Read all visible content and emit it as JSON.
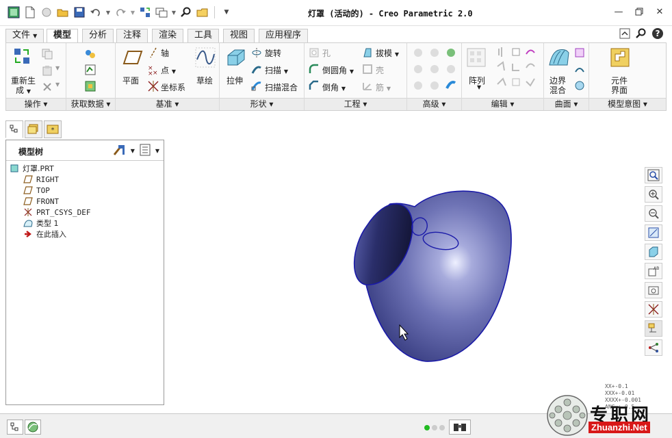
{
  "window": {
    "title": "灯罩 (活动的) - Creo Parametric 2.0"
  },
  "tabs": [
    {
      "label": "文件",
      "has_menu": true
    },
    {
      "label": "模型",
      "active": true
    },
    {
      "label": "分析"
    },
    {
      "label": "注释"
    },
    {
      "label": "渲染"
    },
    {
      "label": "工具"
    },
    {
      "label": "视图"
    },
    {
      "label": "应用程序"
    }
  ],
  "ribbon": {
    "groups": {
      "operations": "操作",
      "get_data": "获取数据",
      "datum": "基准",
      "shapes": "形状",
      "engineering": "工程",
      "advanced": "高级",
      "editing": "编辑",
      "surfaces": "曲面",
      "model_intent": "模型意图"
    },
    "buttons": {
      "regenerate_1": "重新生",
      "regenerate_2": "成",
      "plane": "平面",
      "axis": "轴",
      "point": "点",
      "csys": "坐标系",
      "sketch": "草绘",
      "extrude": "拉伸",
      "revolve": "旋转",
      "sweep": "扫描",
      "swept_blend": "扫描混合",
      "hole": "孔",
      "draft": "拔模",
      "round": "倒圆角",
      "shell": "壳",
      "chamfer": "倒角",
      "rib": "筋",
      "pattern": "阵列",
      "boundary_blend_1": "边界",
      "boundary_blend_2": "混合",
      "component_interface_1": "元件",
      "component_interface_2": "界面"
    }
  },
  "model_tree": {
    "title": "模型树",
    "nodes": [
      {
        "label": "灯罩.PRT",
        "icon": "part-icon"
      },
      {
        "label": "RIGHT",
        "icon": "datum-plane-icon"
      },
      {
        "label": "TOP",
        "icon": "datum-plane-icon"
      },
      {
        "label": "FRONT",
        "icon": "datum-plane-icon"
      },
      {
        "label": "PRT_CSYS_DEF",
        "icon": "csys-icon"
      },
      {
        "label": "类型 1",
        "icon": "boundary-blend-icon"
      },
      {
        "label": "在此插入",
        "icon": "insert-here-icon"
      }
    ]
  },
  "tolerance": [
    "XX+-0.1",
    "XXX+-0.01",
    "XXXX+-0.001",
    "ANG.+-0.5"
  ],
  "watermark": {
    "text": "专职网",
    "url": "Zhuanzhi.Net"
  },
  "colors": {
    "model_fill": "#6e73b5",
    "model_edge": "#1a1aa8",
    "accent": "#2a4fa8"
  }
}
